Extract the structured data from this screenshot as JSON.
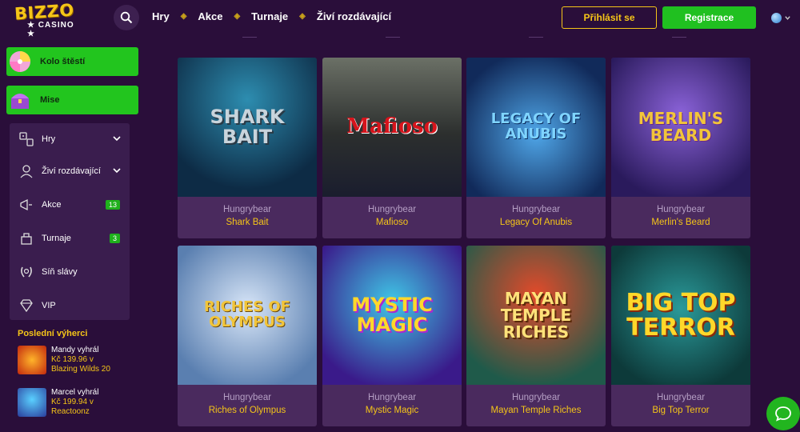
{
  "brand": {
    "logo_line1": "BIZZO",
    "logo_line2": "★ CASINO ★"
  },
  "nav": {
    "items": [
      "Hry",
      "Akce",
      "Turnaje",
      "Živí rozdávající"
    ]
  },
  "auth": {
    "login": "Přihlásit se",
    "register": "Registrace"
  },
  "colors": {
    "bg": "#2a0e3a",
    "accent_yellow": "#f5c518",
    "accent_green": "#22c51e",
    "card": "#4a2a5e",
    "panel": "#3a1d4e"
  },
  "sidebar": {
    "promos": [
      {
        "label": "Kolo štěstí",
        "icon": "wheel-icon"
      },
      {
        "label": "Mise",
        "icon": "treasure-chest-icon"
      }
    ],
    "menu": [
      {
        "label": "Hry",
        "icon": "games-icon",
        "expandable": true
      },
      {
        "label": "Živí rozdávající",
        "icon": "dealer-icon",
        "expandable": true
      },
      {
        "label": "Akce",
        "icon": "megaphone-icon",
        "badge": "13"
      },
      {
        "label": "Turnaje",
        "icon": "tournament-icon",
        "badge": "3"
      },
      {
        "label": "Síň slávy",
        "icon": "laurel-icon"
      },
      {
        "label": "VIP",
        "icon": "diamond-icon"
      }
    ],
    "winners_title": "Poslední výherci",
    "winners": [
      {
        "line1": "Mandy vyhrál",
        "line2": "Kč 139.96 v",
        "line3": "Blazing Wilds 20"
      },
      {
        "line1": "Marcel vyhrál",
        "line2": "Kč 199.94 v",
        "line3": "Reactoonz"
      }
    ]
  },
  "games": [
    {
      "title_art": "SHARK BAIT",
      "provider": "Hungrybear",
      "name": "Shark Bait"
    },
    {
      "title_art": "Mafioso",
      "provider": "Hungrybear",
      "name": "Mafioso"
    },
    {
      "title_art": "LEGACY OF ANUBIS",
      "provider": "Hungrybear",
      "name": "Legacy Of Anubis"
    },
    {
      "title_art": "MERLIN'S BEARD",
      "provider": "Hungrybear",
      "name": "Merlin's Beard"
    },
    {
      "title_art": "RICHES OF OLYMPUS",
      "provider": "Hungrybear",
      "name": "Riches of Olympus"
    },
    {
      "title_art": "MYSTIC MAGIC",
      "provider": "Hungrybear",
      "name": "Mystic Magic"
    },
    {
      "title_art": "MAYAN TEMPLE RICHES",
      "provider": "Hungrybear",
      "name": "Mayan Temple Riches"
    },
    {
      "title_art": "BIG TOP TERROR",
      "provider": "Hungrybear",
      "name": "Big Top Terror"
    }
  ]
}
